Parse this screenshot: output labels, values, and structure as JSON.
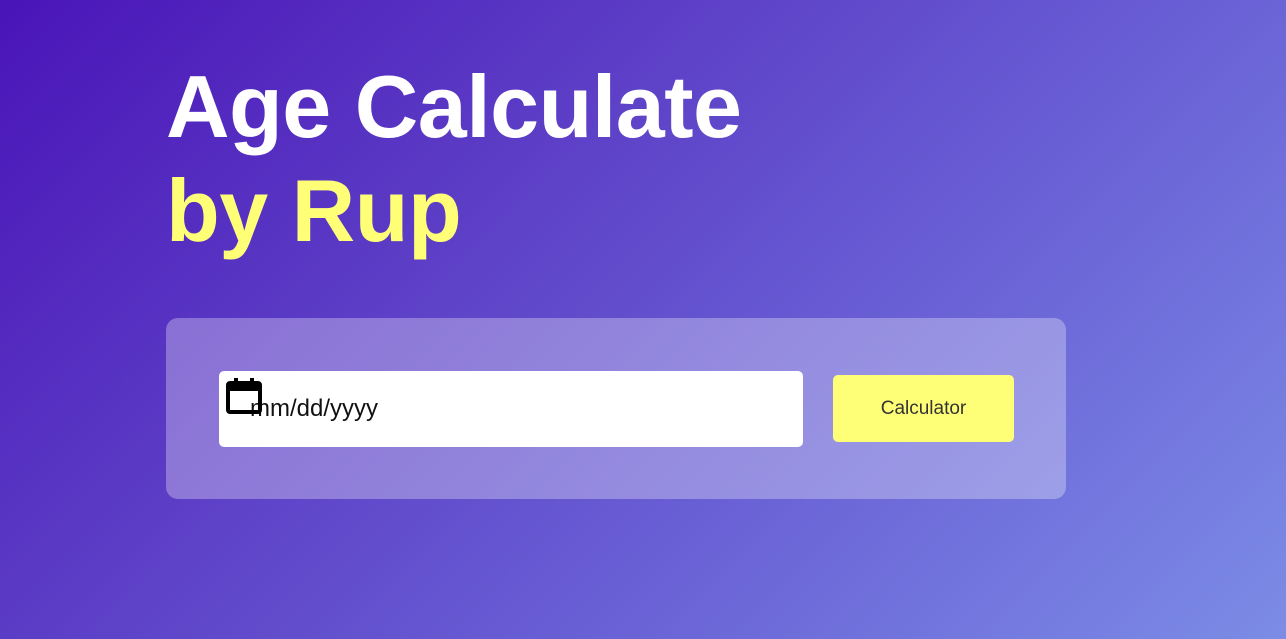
{
  "header": {
    "title_line1": "Age Calculate",
    "title_line2": "by Rup"
  },
  "form": {
    "date_placeholder": "mm/dd/yyyy",
    "date_value": "",
    "calendar_icon": "calendar-icon",
    "submit_label": "Calculator"
  },
  "colors": {
    "background_start": "#4a14b8",
    "background_end": "#7c8ce6",
    "title_primary": "#ffffff",
    "title_accent": "#ffff77",
    "button_bg": "#ffff77"
  }
}
